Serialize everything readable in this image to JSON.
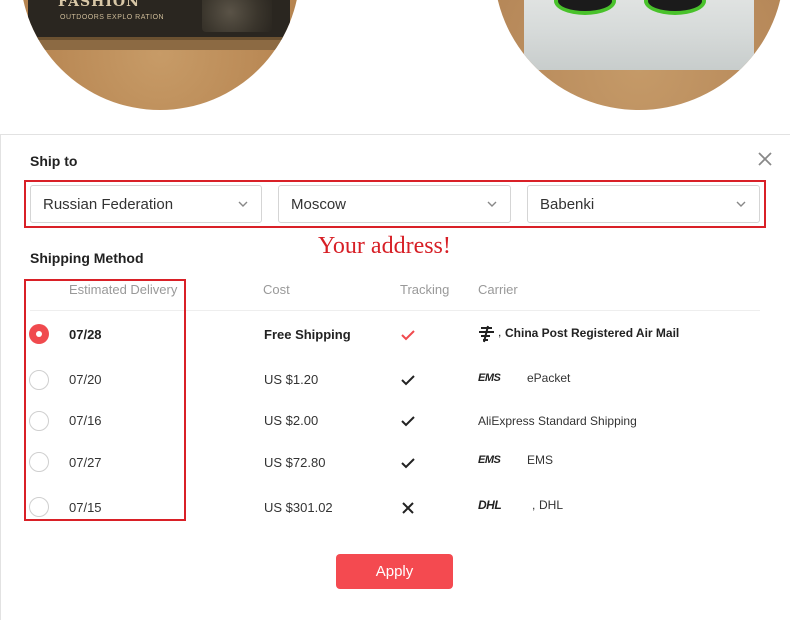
{
  "photos": {
    "left_box_brand": "FASHION",
    "left_box_tagline": "OUTDOORS EXPLO RATION"
  },
  "ship_to": {
    "title": "Ship to",
    "country": "Russian Federation",
    "city": "Moscow",
    "area": "Babenki",
    "annotation": "Your address!"
  },
  "shipping_method": {
    "title": "Shipping Method",
    "headers": {
      "delivery": "Estimated Delivery",
      "cost": "Cost",
      "tracking": "Tracking",
      "carrier": "Carrier"
    },
    "rows": [
      {
        "date": "07/28",
        "cost": "Free Shipping",
        "tracking": "check-red",
        "carrier_logo": "china-post-icon",
        "carrier": "China Post Registered Air Mail",
        "selected": true
      },
      {
        "date": "07/20",
        "cost": "US $1.20",
        "tracking": "check",
        "carrier_logo_text": "EMS",
        "carrier": "ePacket",
        "selected": false
      },
      {
        "date": "07/16",
        "cost": "US $2.00",
        "tracking": "check",
        "carrier": "AliExpress Standard Shipping",
        "selected": false
      },
      {
        "date": "07/27",
        "cost": "US $72.80",
        "tracking": "check",
        "carrier_logo_text": "EMS",
        "carrier": "EMS",
        "selected": false
      },
      {
        "date": "07/15",
        "cost": "US $301.02",
        "tracking": "cross",
        "carrier_logo_text": "DHL",
        "carrier": "DHL",
        "selected": false
      }
    ]
  },
  "apply_label": "Apply",
  "colors": {
    "accent": "#f44a50",
    "annotation": "#d71f26",
    "selected_radio": "#f04a4e"
  }
}
